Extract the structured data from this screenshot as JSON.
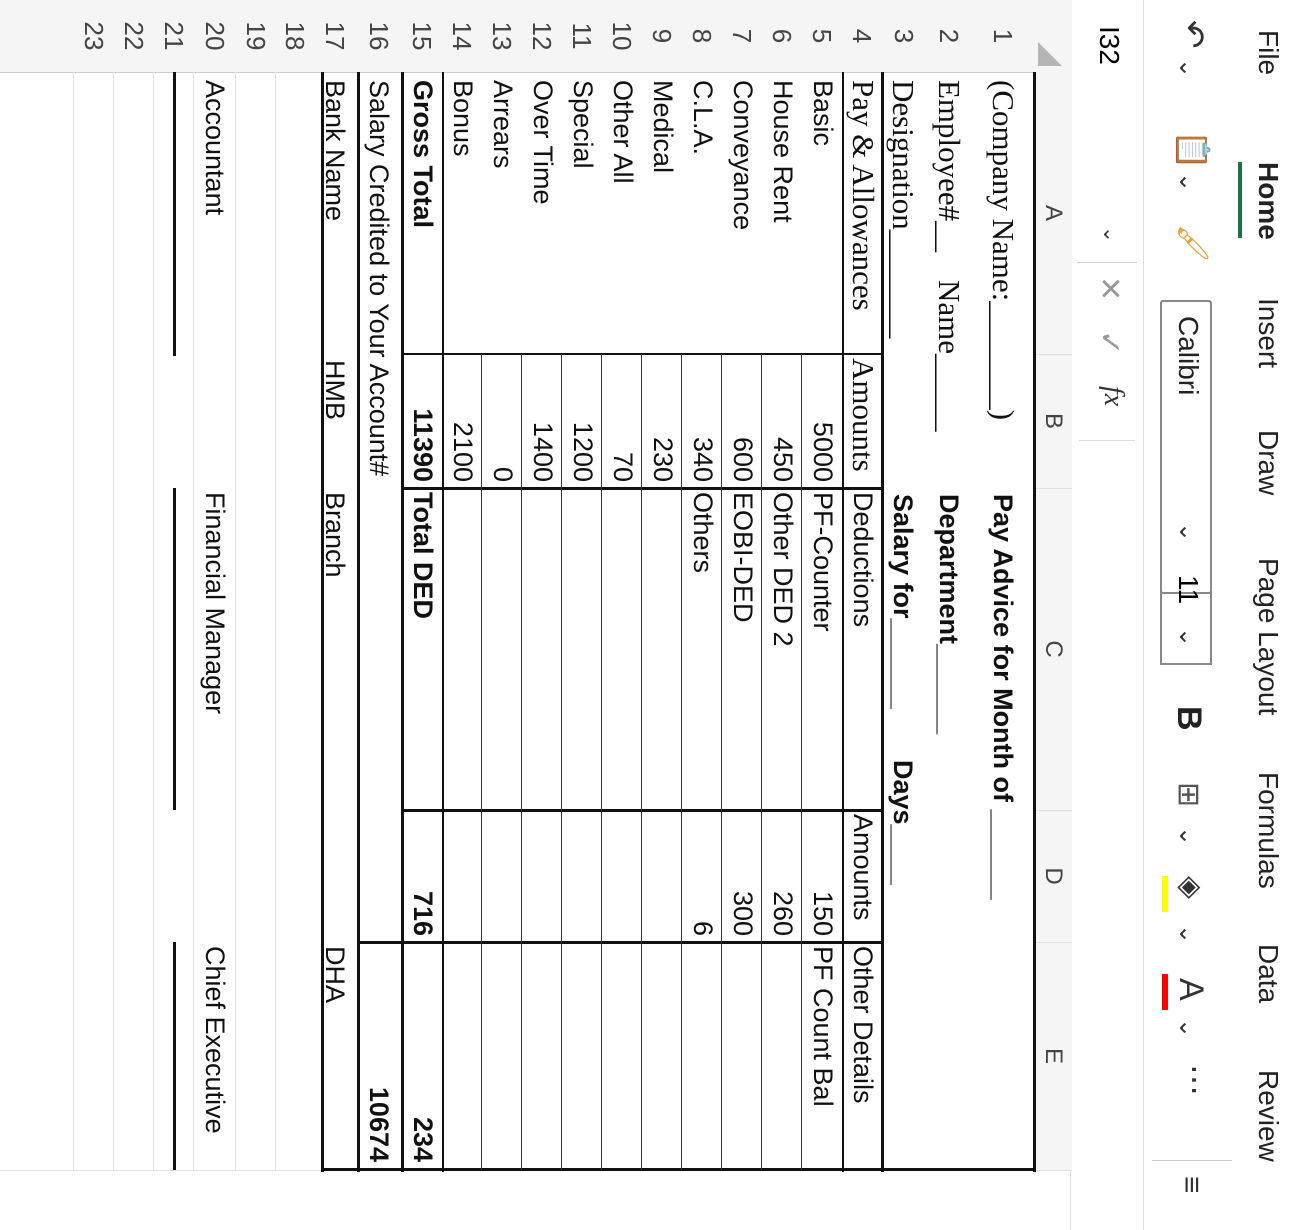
{
  "ribbon": {
    "tabs": [
      {
        "label": "File",
        "active": false
      },
      {
        "label": "Home",
        "active": true
      },
      {
        "label": "Insert",
        "active": false
      },
      {
        "label": "Draw",
        "active": false
      },
      {
        "label": "Page Layout",
        "active": false
      },
      {
        "label": "Formulas",
        "active": false
      },
      {
        "label": "Data",
        "active": false
      },
      {
        "label": "Review",
        "active": false
      }
    ],
    "accent": "#1e7145"
  },
  "toolbar": {
    "font_name": "Calibri",
    "font_size": "11",
    "bold_label": "B",
    "highlight_color": "#ffff00",
    "font_color": "#ff0000"
  },
  "formula_bar": {
    "name_box": "I32",
    "fx_label": "fx"
  },
  "columns": [
    "A",
    "B",
    "C",
    "D",
    "E"
  ],
  "rows": [
    "1",
    "2",
    "3",
    "4",
    "5",
    "6",
    "7",
    "8",
    "9",
    "10",
    "11",
    "12",
    "13",
    "14",
    "15",
    "16",
    "17",
    "18",
    "19",
    "20",
    "21",
    "22",
    "23"
  ],
  "sheet": {
    "company": "(Company Name:_______)",
    "title": "Pay Advice for Month of ______",
    "employee": "Employee#__",
    "name": "Name_____",
    "department": "Department______",
    "designation": "Designation_______",
    "salary_for": "Salary for______",
    "days": "Days____",
    "headers": {
      "pay": "Pay & Allowances",
      "amounts": "Amounts",
      "deductions": "Deductions",
      "amounts2": "Amounts",
      "other": "Other Details"
    },
    "items": [
      {
        "pay": "Basic",
        "amt": "5000",
        "ded": "PF-Counter",
        "damt": "150",
        "other": "PF Count Bal"
      },
      {
        "pay": "House Rent",
        "amt": "450",
        "ded": "Other DED 2",
        "damt": "260",
        "other": ""
      },
      {
        "pay": "Conveyance",
        "amt": "600",
        "ded": "EOBI-DED",
        "damt": "300",
        "other": ""
      },
      {
        "pay": "C.L.A.",
        "amt": "340",
        "ded": "Others",
        "damt": "6",
        "other": ""
      },
      {
        "pay": "Medical",
        "amt": "230",
        "ded": "",
        "damt": "",
        "other": ""
      },
      {
        "pay": "Other All",
        "amt": "70",
        "ded": "",
        "damt": "",
        "other": ""
      },
      {
        "pay": "Special",
        "amt": "1200",
        "ded": "",
        "damt": "",
        "other": ""
      },
      {
        "pay": "Over Time",
        "amt": "1400",
        "ded": "",
        "damt": "",
        "other": ""
      },
      {
        "pay": "Arrears",
        "amt": "0",
        "ded": "",
        "damt": "",
        "other": ""
      },
      {
        "pay": "Bonus",
        "amt": "2100",
        "ded": "",
        "damt": "",
        "other": ""
      }
    ],
    "gross_label": "Gross Total",
    "gross_value": "11390",
    "total_ded_label": "Total DED",
    "total_ded_value": "716",
    "other_total": "234",
    "credited_label": "Salary Credited to Your Account#",
    "credited_value": "10674",
    "bank_label": "Bank Name",
    "bank_value": "HMB",
    "branch_label": "Branch",
    "branch_value": "DHA",
    "sig_accountant": "Accountant",
    "sig_fm": "Financial Manager",
    "sig_ce": "Chief Executive"
  }
}
